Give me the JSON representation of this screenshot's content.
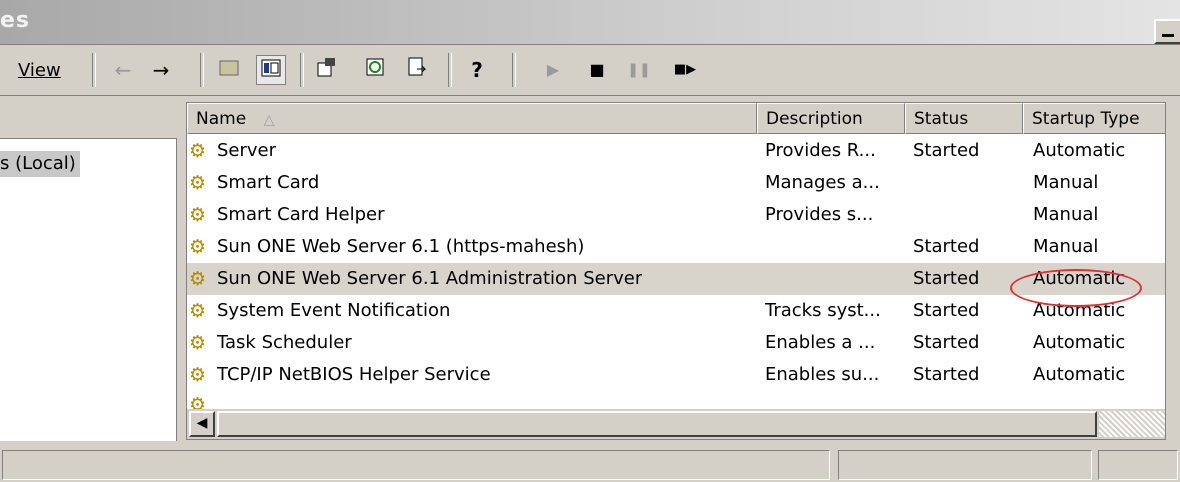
{
  "window": {
    "title": "es"
  },
  "menu": {
    "view_label": "View"
  },
  "toolbar": {
    "back_icon": "←",
    "forward_icon": "→",
    "play_icon": "▶",
    "stop_icon": "■",
    "pause_icon": "❚❚",
    "restart_icon": "■▶",
    "help_icon": "?"
  },
  "tree": {
    "item_label": "s (Local)"
  },
  "columns": [
    "Name",
    "Description",
    "Status",
    "Startup Type"
  ],
  "sort_arrow": "△",
  "rows": [
    {
      "name": "Server",
      "description": "Provides R...",
      "status": "Started",
      "startup": "Automatic"
    },
    {
      "name": "Smart Card",
      "description": "Manages a...",
      "status": "",
      "startup": "Manual"
    },
    {
      "name": "Smart Card Helper",
      "description": "Provides s...",
      "status": "",
      "startup": "Manual"
    },
    {
      "name": "Sun ONE Web Server 6.1 (https-mahesh)",
      "description": "",
      "status": "Started",
      "startup": "Manual"
    },
    {
      "name": "Sun ONE Web Server 6.1 Administration Server",
      "description": "",
      "status": "Started",
      "startup": "Automatic"
    },
    {
      "name": "System Event Notification",
      "description": "Tracks syst...",
      "status": "Started",
      "startup": "Automatic"
    },
    {
      "name": "Task Scheduler",
      "description": "Enables a ...",
      "status": "Started",
      "startup": "Automatic"
    },
    {
      "name": "TCP/IP NetBIOS Helper Service",
      "description": "Enables su...",
      "status": "Started",
      "startup": "Automatic"
    }
  ],
  "selected_row_index": 4,
  "annotation_color": "#e03030"
}
